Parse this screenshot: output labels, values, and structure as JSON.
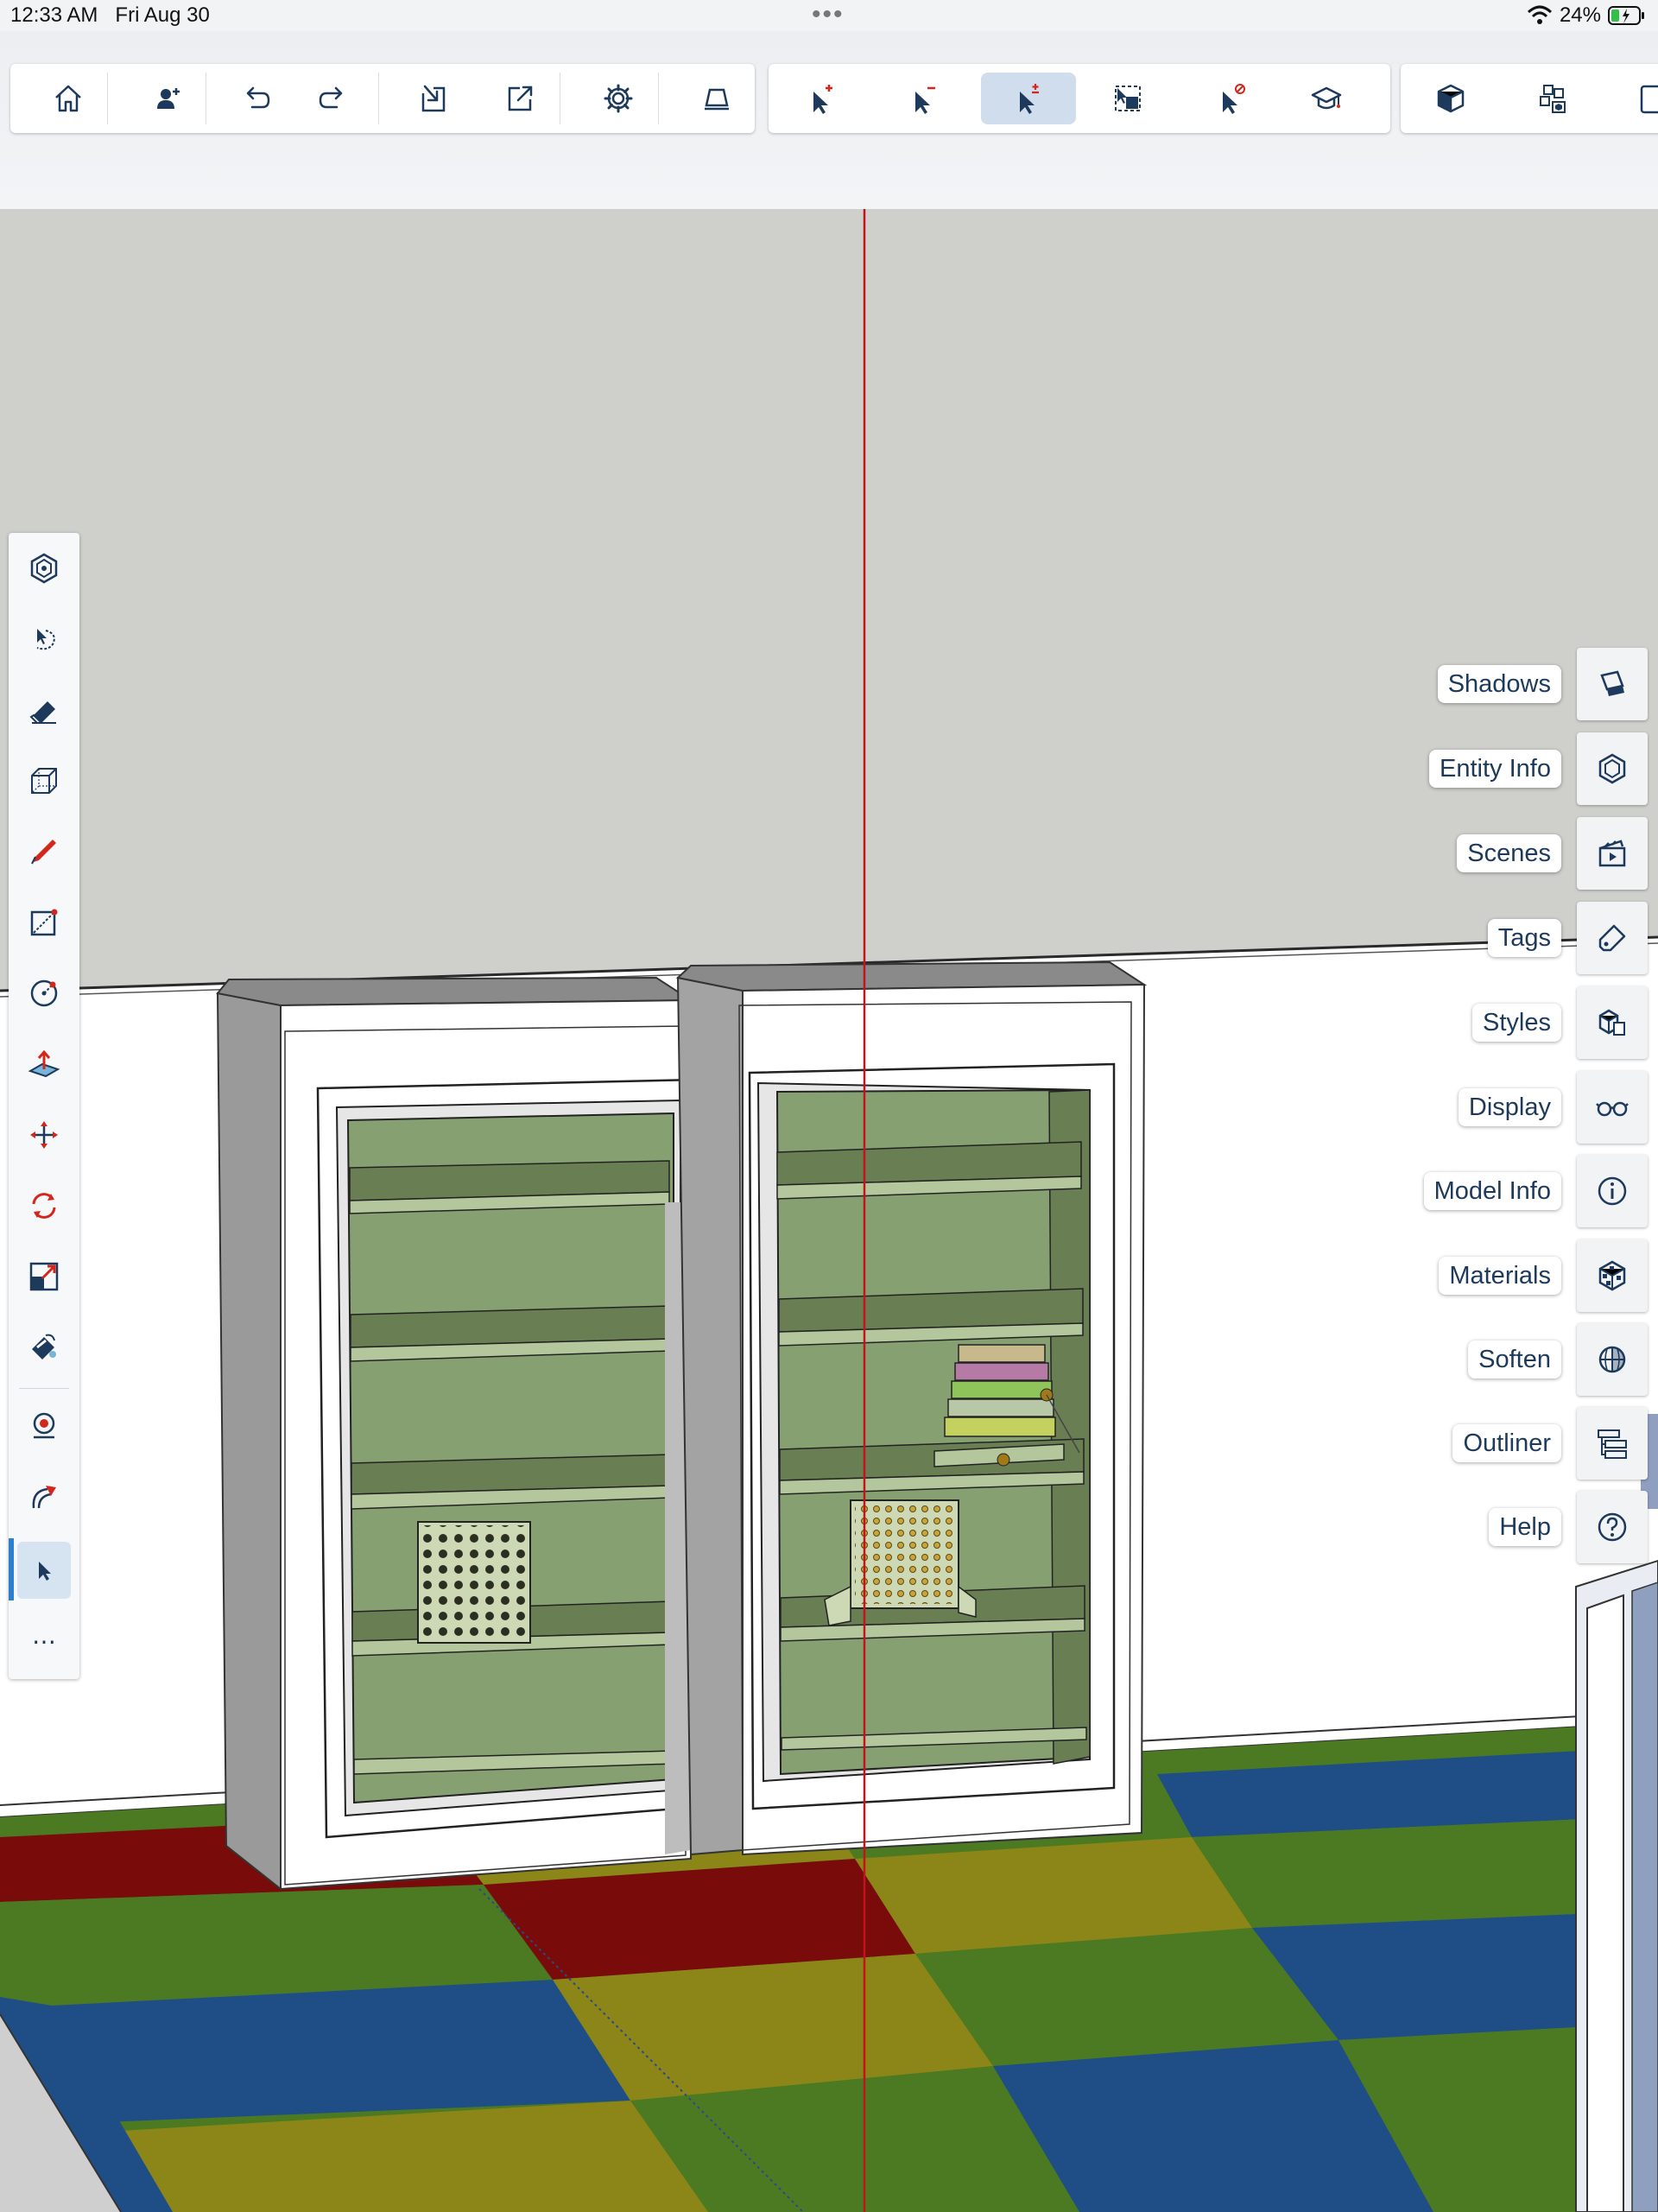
{
  "status_bar": {
    "time": "12:33 AM",
    "date": "Fri Aug 30",
    "more": "•••",
    "battery": "24%"
  },
  "top_toolbar": {
    "group1": [
      "home-icon",
      "add-user-icon",
      "undo-icon",
      "redo-icon",
      "import-icon",
      "export-icon",
      "settings-icon",
      "eraser-view-icon"
    ],
    "group2": [
      "select-add-icon",
      "select-subtract-icon",
      "select-toggle-icon",
      "select-region-icon",
      "select-exclude-icon",
      "instructor-icon"
    ],
    "group3": [
      "solid-view-icon",
      "components-icon",
      "layers-icon"
    ],
    "active": "select-toggle-icon"
  },
  "left_toolbar": {
    "tools": [
      "orbit-icon",
      "lasso-select-icon",
      "eraser-icon",
      "box-icon",
      "pencil-icon",
      "rectangle-icon",
      "circle-icon",
      "push-pull-icon",
      "move-icon",
      "rotate-icon",
      "scale-icon",
      "paint-bucket-icon",
      "tape-measure-icon",
      "follow-me-icon",
      "select-arrow-icon",
      "more-icon"
    ],
    "active": "select-arrow-icon",
    "more_label": "⋯"
  },
  "right_panels": [
    {
      "label": "Shadows",
      "icon": "shadows-icon"
    },
    {
      "label": "Entity Info",
      "icon": "entity-info-icon"
    },
    {
      "label": "Scenes",
      "icon": "scenes-icon"
    },
    {
      "label": "Tags",
      "icon": "tags-icon"
    },
    {
      "label": "Styles",
      "icon": "styles-icon"
    },
    {
      "label": "Display",
      "icon": "display-icon"
    },
    {
      "label": "Model Info",
      "icon": "info-icon"
    },
    {
      "label": "Materials",
      "icon": "materials-icon"
    },
    {
      "label": "Soften",
      "icon": "soften-icon"
    },
    {
      "label": "Outliner",
      "icon": "outliner-icon"
    },
    {
      "label": "Help",
      "icon": "help-icon"
    }
  ],
  "colors": {
    "axis_red": "#c2141b",
    "wall_upper": "#cfd0cc",
    "wall_lower": "#ffffff",
    "cabinet_interior": "#86a072",
    "mat_red": "#7a0b0b",
    "mat_green": "#4c7a22",
    "mat_blue": "#1f4e86",
    "mat_yellow": "#8c8518",
    "accent": "#2a7fd1"
  }
}
